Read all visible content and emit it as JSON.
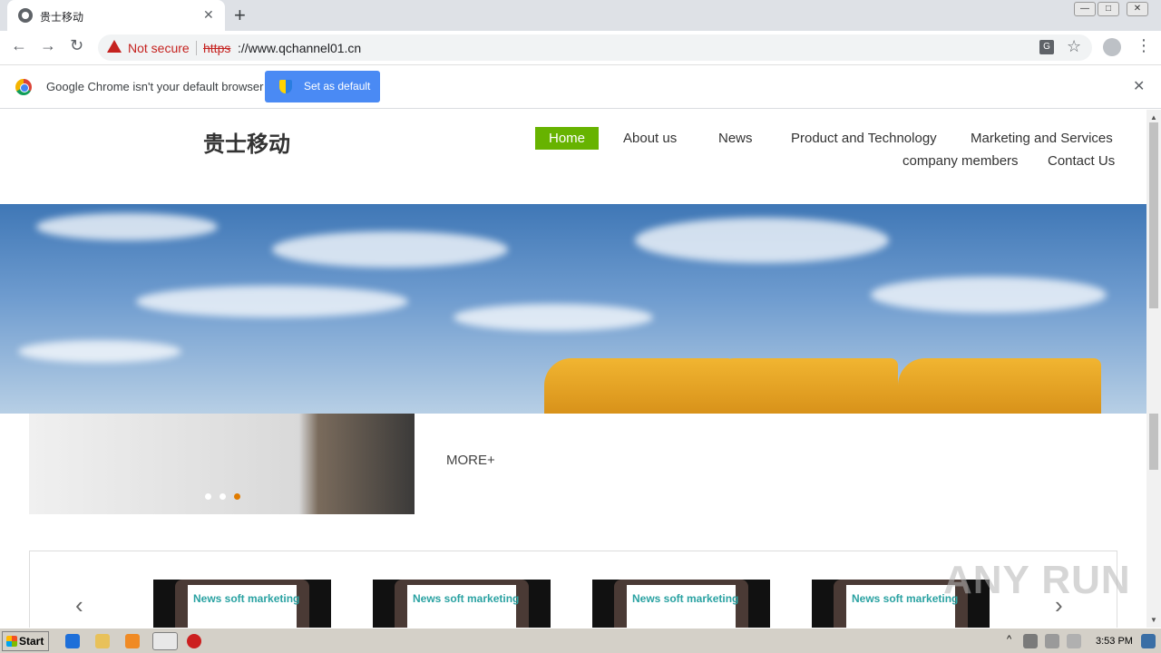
{
  "browser": {
    "tab_title": "贵士移动",
    "new_tab_symbol": "+",
    "tab_close_symbol": "✕",
    "security_label": "Not secure",
    "url_scheme": "https",
    "url_rest": "://www.qchannel01.cn",
    "infobar_text": "Google Chrome isn't your default browser",
    "set_default_label": "Set as default",
    "infobar_close_symbol": "✕"
  },
  "site": {
    "logo": "贵士移动",
    "nav": {
      "home": "Home",
      "about": "About us",
      "news": "News",
      "product": "Product and Technology",
      "marketing": "Marketing and Services",
      "members": "company members",
      "contact": "Contact Us"
    },
    "more_label": "MORE+",
    "product_cards": [
      "News soft marketing",
      "News soft marketing",
      "News soft marketing",
      "News soft marketing"
    ],
    "watermark": "ANY RUN"
  },
  "taskbar": {
    "start_label": "Start",
    "time": "3:53 PM"
  },
  "colors": {
    "nav_active": "#67b300",
    "warning": "#c5221f",
    "set_default_button": "#4a8af4"
  }
}
